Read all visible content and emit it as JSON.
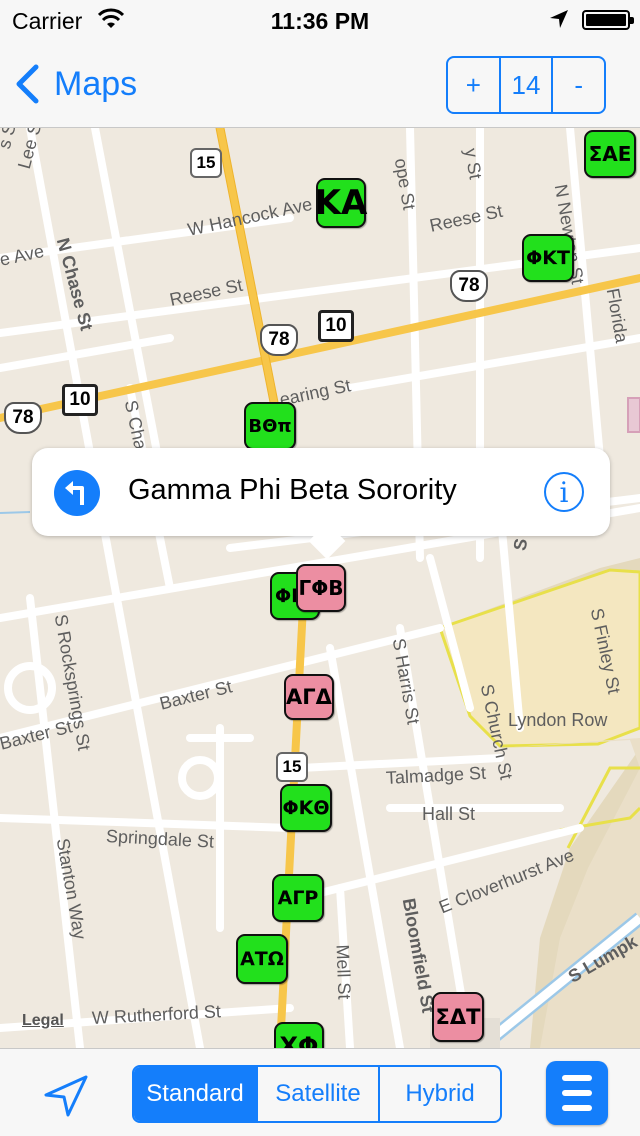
{
  "status_bar": {
    "carrier": "Carrier",
    "time": "11:36 PM"
  },
  "nav": {
    "back_label": "Maps",
    "zoom_in": "+",
    "zoom_level": "14",
    "zoom_out": "-"
  },
  "map": {
    "streets": {
      "lee": "Lee St",
      "n_chase": "N Chase St",
      "hancock": "W Hancock Ave",
      "reese_w": "Reese St",
      "reese_e": "Reese St",
      "ave_w": "e Ave",
      "pope_top": "ope St",
      "jy_st": "y St",
      "n_newton": "N Newton St",
      "florida": "Florida",
      "s_chase": "S Chase St",
      "dearing": "earing St",
      "s_pope": "S Pope St",
      "s_rocksprings": "S Rocksprings St",
      "baxter_e": "Baxter St",
      "baxter_w": "Baxter St",
      "s_harris": "S Harris St",
      "s_church": "S Church St",
      "s_finley": "S Finley St",
      "lyndon": "Lyndon Row",
      "talmadge": "Talmadge St",
      "hall": "Hall St",
      "springdale": "Springdale St",
      "stanton": "Stanton Way",
      "cloverhurst": "E Cloverhurst Ave",
      "bloomfield": "Bloomfield St",
      "mell": "Mell St",
      "rutherford": "W Rutherford St",
      "s_lumpkin": "S Lumpk",
      "ss": "s St"
    },
    "shields": {
      "r15_top": "15",
      "r15_bot": "15",
      "us78_a": "78",
      "us78_b": "78",
      "us78_c": "78",
      "ga10_a": "10",
      "ga10_b": "10"
    },
    "legal": "Legal",
    "pins": [
      {
        "label": "ΣΑΕ",
        "color": "green"
      },
      {
        "label": "ΚΑ",
        "color": "green"
      },
      {
        "label": "ΦΚΤ",
        "color": "green"
      },
      {
        "label": "ΒΘπ",
        "color": "green"
      },
      {
        "label": "ΦΚ",
        "color": "green"
      },
      {
        "label": "ΓΦΒ",
        "color": "pink"
      },
      {
        "label": "ΑΓΔ",
        "color": "pink"
      },
      {
        "label": "ΦΚΘ",
        "color": "green"
      },
      {
        "label": "ΑΓΡ",
        "color": "green"
      },
      {
        "label": "ΑΤΩ",
        "color": "green"
      },
      {
        "label": "ΣΔΤ",
        "color": "pink"
      },
      {
        "label": "ΧΦ",
        "color": "green"
      }
    ],
    "callout": {
      "title": "Gamma Phi Beta Sorority",
      "info_glyph": "i"
    }
  },
  "toolbar": {
    "segments": [
      "Standard",
      "Satellite",
      "Hybrid"
    ],
    "selected": "Standard"
  },
  "colors": {
    "accent": "#147efb",
    "greek_green": "#22e01c",
    "greek_pink": "#ec8ea2",
    "map_bg": "#efe9df",
    "highway": "#f7c64a"
  }
}
